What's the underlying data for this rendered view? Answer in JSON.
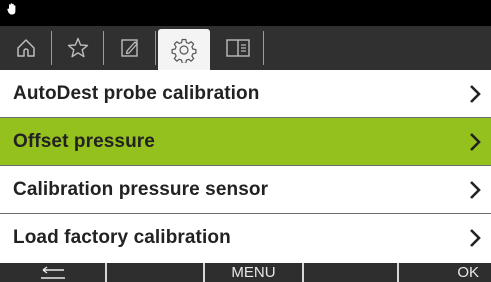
{
  "status_bar": {
    "icon": "hand-icon"
  },
  "tabs": [
    {
      "icon": "home-icon",
      "active": false
    },
    {
      "icon": "star-icon",
      "active": false
    },
    {
      "icon": "edit-icon",
      "active": false
    },
    {
      "icon": "gear-icon",
      "active": true
    },
    {
      "icon": "book-icon",
      "active": false
    }
  ],
  "menu": {
    "items": [
      {
        "label": "AutoDest probe calibration",
        "highlighted": false
      },
      {
        "label": "Offset pressure",
        "highlighted": true
      },
      {
        "label": "Calibration pressure sensor",
        "highlighted": false
      },
      {
        "label": "Load factory calibration",
        "highlighted": false
      }
    ]
  },
  "softkeys": {
    "back_icon": "back-arrow-icon",
    "key2": "",
    "key3": "MENU",
    "key4": "",
    "key5": "OK"
  },
  "colors": {
    "highlight": "#95c11f",
    "tabbar": "#303030",
    "softkeys": "#2e2e2e"
  }
}
